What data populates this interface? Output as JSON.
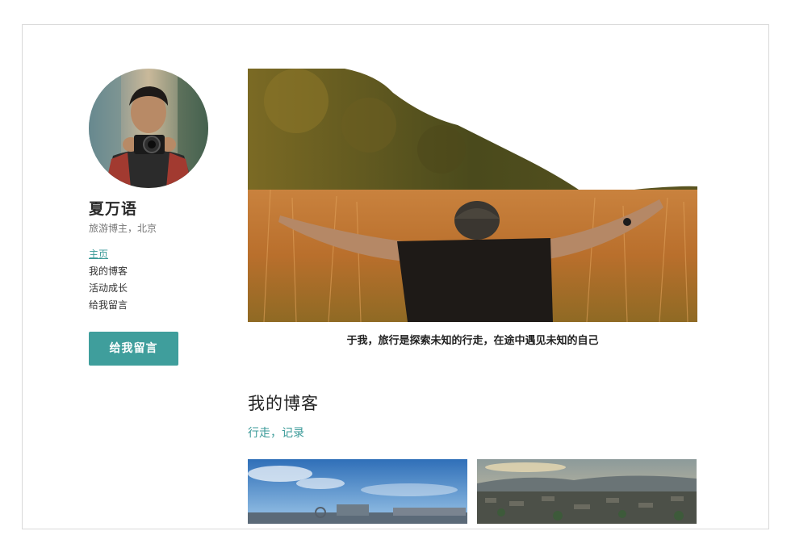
{
  "profile": {
    "name": "夏万语",
    "subtitle": "旅游博主，北京"
  },
  "nav": {
    "items": [
      {
        "label": "主页",
        "active": true
      },
      {
        "label": "我的博客",
        "active": false
      },
      {
        "label": "活动成长",
        "active": false
      },
      {
        "label": "给我留言",
        "active": false
      }
    ]
  },
  "cta": {
    "label": "给我留言"
  },
  "hero": {
    "caption": "于我，旅行是探索未知的行走，在途中遇见未知的自己"
  },
  "blog": {
    "title": "我的博客",
    "subtitle": "行走，记录"
  },
  "colors": {
    "accent": "#3f9e9c",
    "border": "#d9d9d9",
    "text": "#2a2a2a"
  }
}
